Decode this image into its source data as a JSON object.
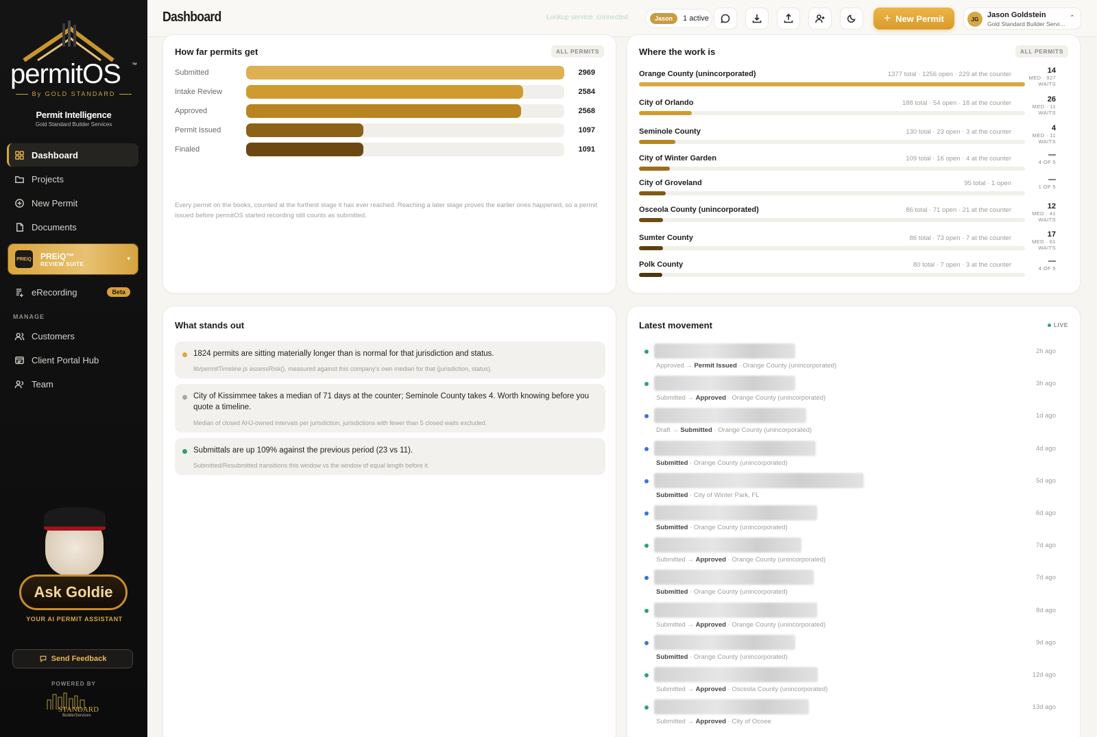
{
  "brand": {
    "wordmark": "permitOS",
    "tm": "™",
    "by": "By GOLD STANDARD",
    "tagline_title": "Permit Intelligence",
    "tagline_sub": "Gold Standard Builder Services"
  },
  "sidebar": {
    "items": [
      {
        "label": "Dashboard",
        "icon": "grid-icon"
      },
      {
        "label": "Projects",
        "icon": "folder-icon"
      },
      {
        "label": "New Permit",
        "icon": "plus-circle-icon"
      },
      {
        "label": "Documents",
        "icon": "document-icon"
      }
    ],
    "preiq": {
      "title": "PREiQ™",
      "subtitle": "REVIEW SUITE",
      "badge": "PREiQ"
    },
    "erecording": {
      "label": "eRecording",
      "badge": "Beta"
    },
    "manage_label": "MANAGE",
    "manage_items": [
      {
        "label": "Customers",
        "icon": "users-icon"
      },
      {
        "label": "Client Portal Hub",
        "icon": "portal-icon"
      },
      {
        "label": "Team",
        "icon": "team-icon"
      }
    ],
    "ask_goldie": "Ask Goldie",
    "ask_goldie_sub": "YOUR AI PERMIT ASSISTANT",
    "feedback": "Send Feedback",
    "powered_by": "POWERED BY",
    "powered_logo_main": "STANDARD",
    "powered_logo_sub": "BuilderServices"
  },
  "header": {
    "title": "Dashboard",
    "lookup_status": "Lookup service: connected",
    "presence_name": "Jason",
    "presence_count": "1 active",
    "new_permit": "New Permit",
    "user_initials": "JG",
    "user_name": "Jason Goldstein",
    "user_company": "Gold Standard Builder Services"
  },
  "funnel": {
    "title": "How far permits get",
    "tag": "ALL PERMITS",
    "stages": [
      {
        "label": "Submitted",
        "value": 2969,
        "color": "#ddb152"
      },
      {
        "label": "Intake Review",
        "value": 2584,
        "color": "#cf9b31"
      },
      {
        "label": "Approved",
        "value": 2568,
        "color": "#b98521"
      },
      {
        "label": "Permit Issued",
        "value": 1097,
        "color": "#8c6118"
      },
      {
        "label": "Finaled",
        "value": 1091,
        "color": "#6b4811"
      }
    ],
    "max": 2969,
    "note": "Every permit on the books, counted at the furthest stage it has ever reached. Reaching a later stage proves the earlier ones happened, so a permit issued before permitOS started recording still counts as submitted."
  },
  "where": {
    "title": "Where the work is",
    "tag": "ALL PERMITS",
    "rows": [
      {
        "name": "Orange County (unincorporated)",
        "meta": "1377 total · 1256 open · 229 at the counter",
        "total": 1377,
        "big": "14",
        "small": "MED · 927 WAITS",
        "color": "#d9a93f"
      },
      {
        "name": "City of Orlando",
        "meta": "188 total · 54 open · 18 at the counter",
        "total": 188,
        "big": "26",
        "small": "MED · 11 WAITS",
        "color": "#cf9b31"
      },
      {
        "name": "Seminole County",
        "meta": "130 total · 23 open · 3 at the counter",
        "total": 130,
        "big": "4",
        "small": "MED · 11 WAITS",
        "color": "#b98521"
      },
      {
        "name": "City of Winter Garden",
        "meta": "109 total · 16 open · 4 at the counter",
        "total": 109,
        "big": "—",
        "small": "4 OF 5",
        "color": "#9c6d1c"
      },
      {
        "name": "City of Groveland",
        "meta": "95 total · 1 open",
        "total": 95,
        "big": "—",
        "small": "1 OF 5",
        "color": "#825a17"
      },
      {
        "name": "Osceola County (unincorporated)",
        "meta": "86 total · 71 open · 21 at the counter",
        "total": 86,
        "big": "12",
        "small": "MED · 41 WAITS",
        "color": "#6e4c13"
      },
      {
        "name": "Sumter County",
        "meta": "86 total · 73 open · 7 at the counter",
        "total": 86,
        "big": "17",
        "small": "MED · 61 WAITS",
        "color": "#5e4111"
      },
      {
        "name": "Polk County",
        "meta": "80 total · 7 open · 3 at the counter",
        "total": 80,
        "big": "—",
        "small": "4 OF 5",
        "color": "#4f370f"
      }
    ],
    "max": 1377
  },
  "insights": {
    "title": "What stands out",
    "items": [
      {
        "text": "1824 permits are sitting materially longer than is normal for that jurisdiction and status.",
        "sub": "lib/permitTimeline.js assessRisk(), measured against this company's own median for that (jurisdiction, status).",
        "color": "#e3a53a"
      },
      {
        "text": "City of Kissimmee takes a median of 71 days at the counter; Seminole County takes 4. Worth knowing before you quote a timeline.",
        "sub": "Median of closed AHJ-owned intervals per jurisdiction, jurisdictions with fewer than 5 closed waits excluded.",
        "color": "#a9a6a0"
      },
      {
        "text": "Submittals are up 109% against the previous period (23 vs 11).",
        "sub": "Submitted/Resubmitted transitions this window vs the window of equal length before it.",
        "color": "#2ea36a"
      }
    ]
  },
  "latest": {
    "title": "Latest movement",
    "live": "LIVE",
    "rows": [
      {
        "from": "Approved → ",
        "to": "Permit Issued",
        "where": " · Orange County (unincorporated)",
        "time": "2h ago",
        "dot": "#2ea36a"
      },
      {
        "from": "Submitted → ",
        "to": "Approved",
        "where": " · Orange County (unincorporated)",
        "time": "3h ago",
        "dot": "#2ea36a"
      },
      {
        "from": "Draft → ",
        "to": "Submitted",
        "where": " · Orange County (unincorporated)",
        "time": "1d ago",
        "dot": "#3d73d9"
      },
      {
        "from": "",
        "to": "Submitted",
        "where": " · Orange County (unincorporated)",
        "time": "4d ago",
        "dot": "#3d73d9"
      },
      {
        "from": "",
        "to": "Submitted",
        "where": " · City of Winter Park, FL",
        "time": "5d ago",
        "dot": "#3d73d9"
      },
      {
        "from": "",
        "to": "Submitted",
        "where": " · Orange County (unincorporated)",
        "time": "6d ago",
        "dot": "#3d73d9"
      },
      {
        "from": "Submitted → ",
        "to": "Approved",
        "where": " · Orange County (unincorporated)",
        "time": "7d ago",
        "dot": "#2ea36a"
      },
      {
        "from": "",
        "to": "Submitted",
        "where": " · Orange County (unincorporated)",
        "time": "7d ago",
        "dot": "#3d73d9"
      },
      {
        "from": "Submitted → ",
        "to": "Approved",
        "where": " · Orange County (unincorporated)",
        "time": "8d ago",
        "dot": "#2ea36a"
      },
      {
        "from": "",
        "to": "Submitted",
        "where": " · Orange County (unincorporated)",
        "time": "9d ago",
        "dot": "#3d73d9"
      },
      {
        "from": "Submitted → ",
        "to": "Approved",
        "where": " · Osceola County (unincorporated)",
        "time": "12d ago",
        "dot": "#2ea36a"
      },
      {
        "from": "Submitted → ",
        "to": "Approved",
        "where": " · City of Ocoee",
        "time": "13d ago",
        "dot": "#2ea36a"
      }
    ]
  }
}
